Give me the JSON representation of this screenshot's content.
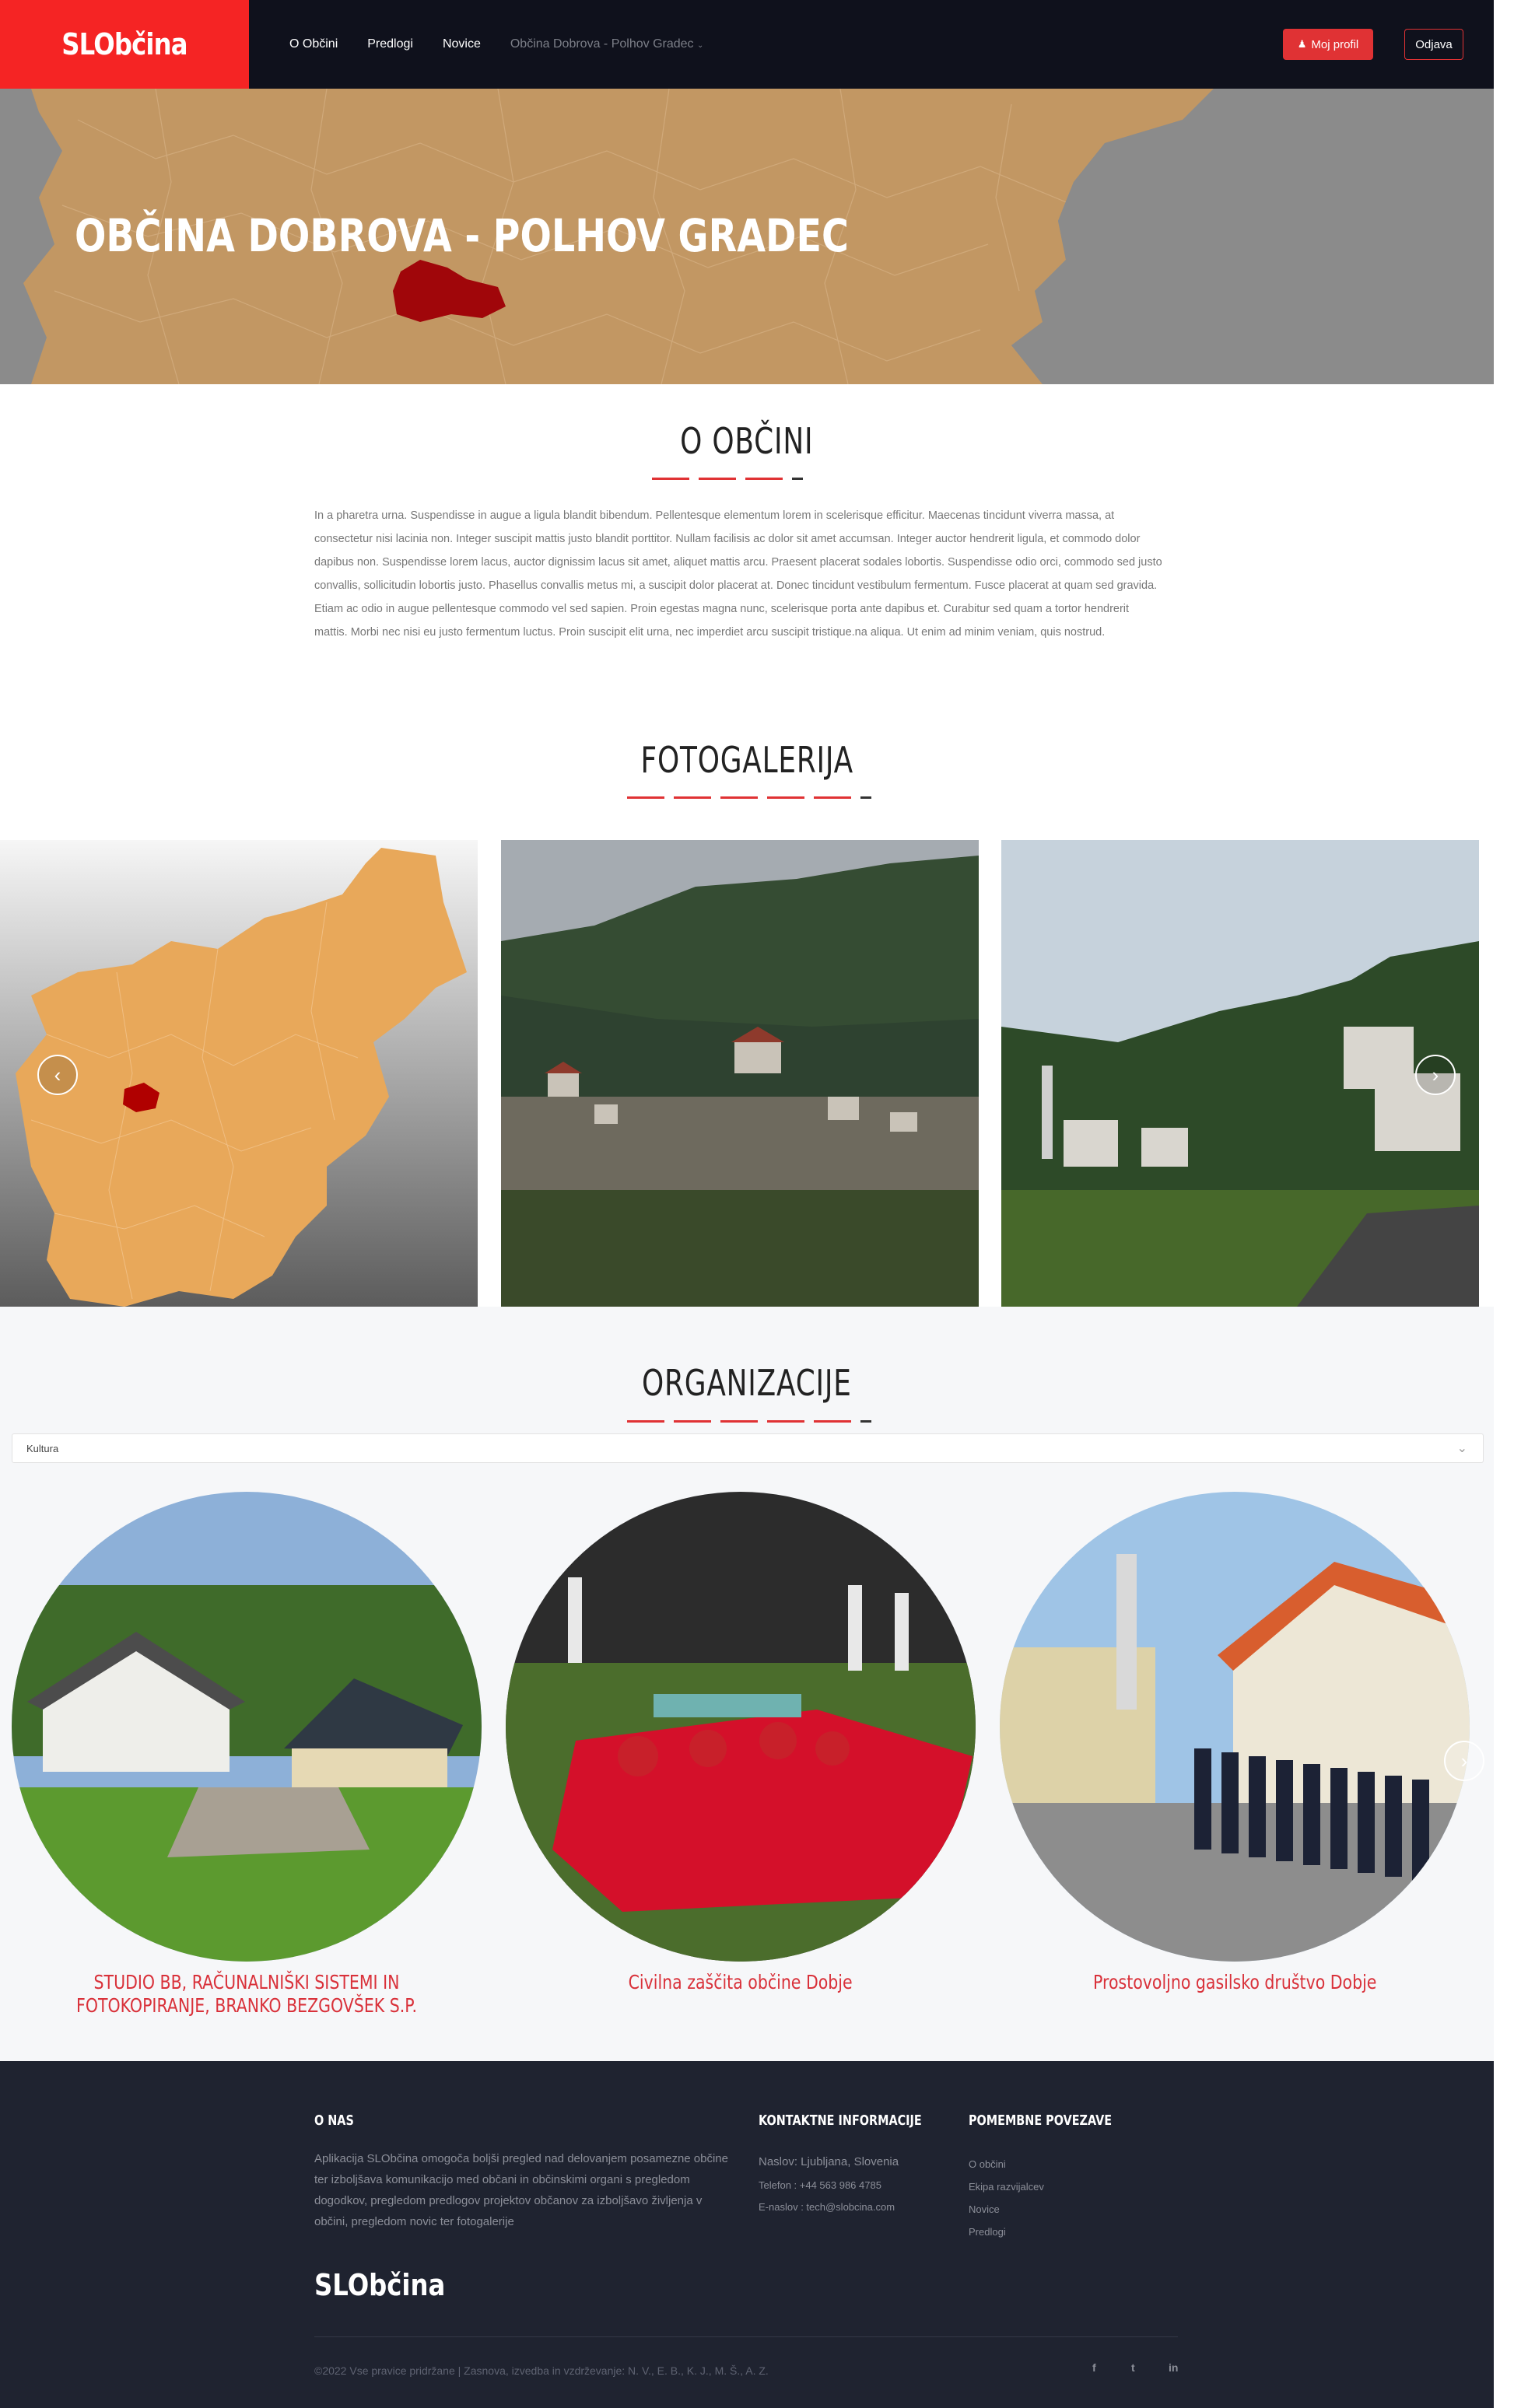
{
  "nav": {
    "brand": "SLObčina",
    "links": [
      "O Občini",
      "Predlogi",
      "Novice",
      "Občina Dobrova - Polhov Gradec"
    ],
    "profile_label": "Moj profil",
    "logout_label": "Odjava"
  },
  "hero": {
    "title": "OBČINA DOBROVA - POLHOV GRADEC"
  },
  "about": {
    "title": "O OBČINI",
    "text": "In a pharetra urna. Suspendisse in augue a ligula blandit bibendum. Pellentesque elementum lorem in scelerisque efficitur. Maecenas tincidunt viverra massa, at consectetur nisi lacinia non. Integer suscipit mattis justo blandit porttitor. Nullam facilisis ac dolor sit amet accumsan. Integer auctor hendrerit ligula, et commodo dolor dapibus non. Suspendisse lorem lacus, auctor dignissim lacus sit amet, aliquet mattis arcu. Praesent placerat sodales lobortis. Suspendisse odio orci, commodo sed justo convallis, sollicitudin lobortis justo. Phasellus convallis metus mi, a suscipit dolor placerat at. Donec tincidunt vestibulum fermentum. Fusce placerat at quam sed gravida. Etiam ac odio in augue pellentesque commodo vel sed sapien. Proin egestas magna nunc, scelerisque porta ante dapibus et. Curabitur sed quam a tortor hendrerit mattis. Morbi nec nisi eu justo fermentum luctus. Proin suscipit elit urna, nec imperdiet arcu suscipit tristique.na aliqua. Ut enim ad minim veniam, quis nostrud."
  },
  "gallery": {
    "title": "FOTOGALERIJA",
    "prev": "‹",
    "next": "›"
  },
  "organizations": {
    "title": "ORGANIZACIJE",
    "filter_value": "Kultura",
    "items": [
      "STUDIO BB, RAČUNALNIŠKI SISTEMI IN FOTOKOPIRANJE, BRANKO BEZGOVŠEK S.P.",
      "Civilna zaščita občine Dobje",
      "Prostovoljno gasilsko društvo Dobje"
    ]
  },
  "footer": {
    "about_title": "O NAS",
    "about_text": "Aplikacija SLObčina omogoča boljši pregled nad delovanjem posamezne občine ter izboljšava komunikacijo med občani in občinskimi organi s pregledom dogodkov, pregledom predlogov projektov občanov za izboljšavo življenja v občini, pregledom novic ter fotogalerije",
    "contact_title": "KONTAKTNE INFORMACIJE",
    "contact_address": "Naslov: Ljubljana, Slovenia",
    "contact_phone": "Telefon : +44 563 986 4785",
    "contact_email": "E-naslov : tech@slobcina.com",
    "links_title": "POMEMBNE POVEZAVE",
    "links": [
      "O občini",
      "Ekipa razvijalcev",
      "Novice",
      "Predlogi"
    ],
    "brand": "SLObčina",
    "copyright": "©2022 Vse pravice pridržane | Zasnova, izvedba in vzdrževanje: N. V., E. B., K. J., M. Š., A. Z.",
    "social": [
      "f",
      "t",
      "in"
    ]
  }
}
